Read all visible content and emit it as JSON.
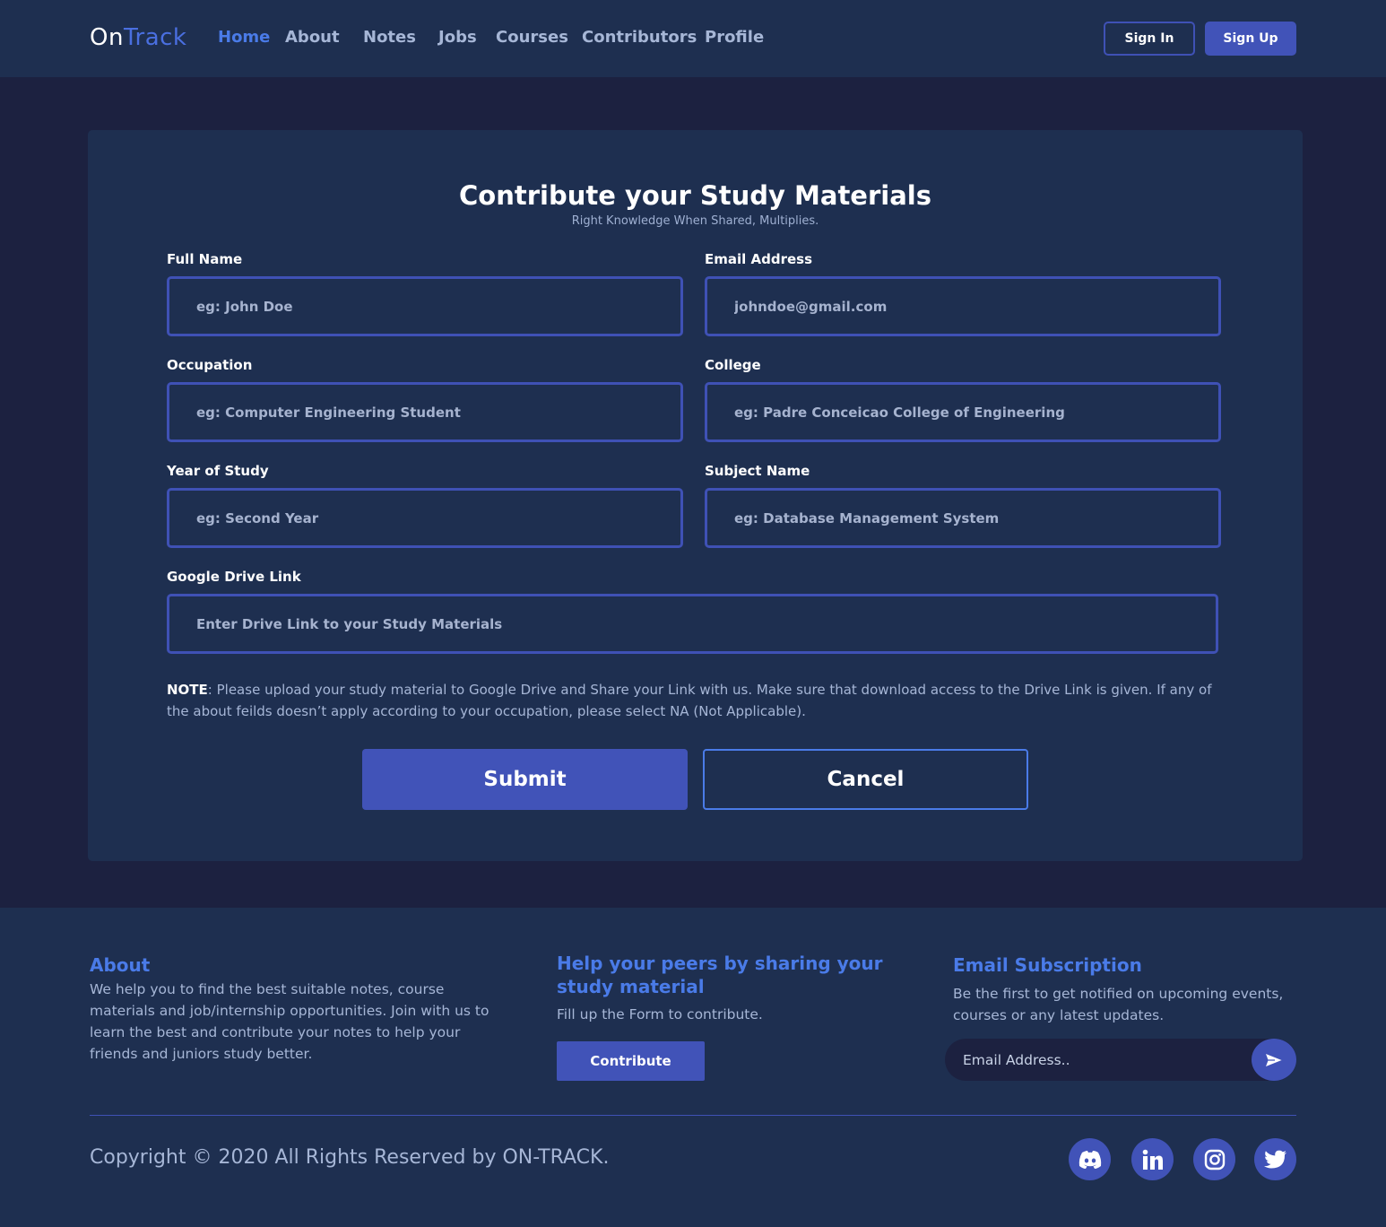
{
  "nav": {
    "logo_prefix": "On",
    "logo_suffix": "Track",
    "links": [
      {
        "label": "Home",
        "active": true
      },
      {
        "label": "About"
      },
      {
        "label": "Notes"
      },
      {
        "label": "Jobs"
      },
      {
        "label": "Courses"
      },
      {
        "label": "Contributors"
      },
      {
        "label": "Profile"
      }
    ],
    "signin_label": "Sign In",
    "signup_label": "Sign Up"
  },
  "form": {
    "title": "Contribute your Study Materials",
    "subtitle": "Right Knowledge When Shared, Multiplies.",
    "fields": {
      "full_name": {
        "label": "Full Name",
        "placeholder": "eg: John Doe"
      },
      "email": {
        "label": "Email Address",
        "placeholder": "johndoe@gmail.com"
      },
      "occupation": {
        "label": "Occupation",
        "placeholder": "eg: Computer Engineering Student"
      },
      "college": {
        "label": "College",
        "placeholder": "eg: Padre Conceicao College of Engineering"
      },
      "year": {
        "label": "Year of Study",
        "placeholder": "eg: Second Year"
      },
      "subject": {
        "label": "Subject Name",
        "placeholder": "eg: Database Management System"
      },
      "drive": {
        "label": "Google Drive Link",
        "placeholder": "Enter Drive Link to your Study Materials"
      }
    },
    "note_label": "NOTE",
    "note_text": ": Please upload your study material to Google Drive and Share your Link with us. Make sure that download access to the Drive Link is given. If any of the about feilds doesn’t apply according to your occupation, please select NA (Not Applicable).",
    "submit_label": "Submit",
    "cancel_label": "Cancel"
  },
  "footer": {
    "about": {
      "heading": "About",
      "text": "We help you to find the best suitable notes, course materials and job/internship opportunities. Join with us to learn the best and contribute your notes to help your friends and juniors study better."
    },
    "help": {
      "heading": "Help your peers by sharing your study material",
      "text": "Fill up the Form to contribute.",
      "button_label": "Contribute"
    },
    "subscription": {
      "heading": "Email Subscription",
      "text": "Be the first to get notified on upcoming events, courses or any latest updates.",
      "placeholder": "Email Address.."
    },
    "copyright": "Copyright © 2020 All Rights Reserved by ON-TRACK.",
    "social": [
      "discord-icon",
      "linkedin-icon",
      "instagram-icon",
      "twitter-icon"
    ]
  },
  "colors": {
    "page_bg": "#1c2140",
    "panel_bg": "#1e2f50",
    "accent": "#4153b8",
    "link_blue": "#4a7be8"
  }
}
